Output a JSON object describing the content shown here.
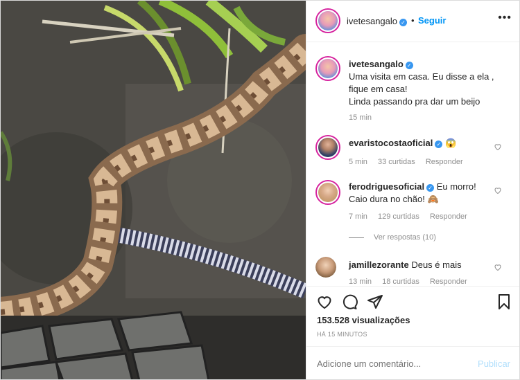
{
  "post": {
    "author": "ivetesangalo",
    "follow_label": "Seguir",
    "dot": "•",
    "more_label": "•••",
    "caption_lines": [
      "Uma visita em casa. Eu disse a ela ,",
      "fique em casa!",
      "Linda passando pra dar um beijo"
    ],
    "caption_time": "15 min"
  },
  "comments": [
    {
      "user": "evaristocostaoficial",
      "text": "😱",
      "time": "5 min",
      "likes": "33 curtidas",
      "reply_label": "Responder"
    },
    {
      "user": "ferodriguesoficial",
      "text_line1": "Eu morro!",
      "text_line2": "Caio dura no chão! 🙈",
      "time": "7 min",
      "likes": "129 curtidas",
      "reply_label": "Responder",
      "view_replies": "Ver respostas (10)"
    },
    {
      "user": "jamillezorante",
      "text": "Deus é mais",
      "time": "13 min",
      "likes": "18 curtidas",
      "reply_label": "Responder"
    }
  ],
  "stats": {
    "views": "153.528 visualizações",
    "posted": "HÁ 15 MINUTOS"
  },
  "composer": {
    "placeholder": "Adicione um comentário...",
    "publish_label": "Publicar"
  },
  "icons": {
    "like": "heart-icon",
    "comment": "comment-icon",
    "share": "paper-plane-icon",
    "save": "bookmark-icon",
    "verified": "verified-badge-icon",
    "more": "more-options-icon"
  },
  "colors": {
    "accent": "#0095f6",
    "verified": "#3897f0",
    "muted": "#8e8e8e",
    "publish_disabled": "#b2dffc"
  }
}
